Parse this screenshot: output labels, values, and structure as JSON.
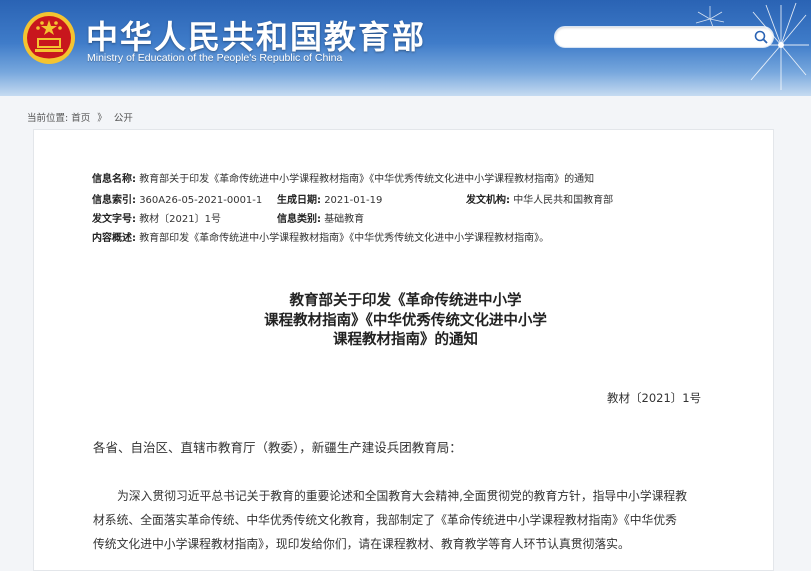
{
  "header": {
    "title": "中华人民共和国教育部",
    "subtitle": "Ministry of Education of the People's Republic of China",
    "search_placeholder": "",
    "search_icon": "search-icon",
    "emblem": "national-emblem"
  },
  "breadcrumb": {
    "prefix": "当前位置:",
    "items": [
      "首页",
      "公开"
    ],
    "separator": "》"
  },
  "meta": {
    "info_name_label": "信息名称:",
    "info_name_value": "教育部关于印发《革命传统进中小学课程教材指南》《中华优秀传统文化进中小学课程教材指南》的通知",
    "index_label": "信息索引:",
    "index_value": "360A26-05-2021-0001-1",
    "date_label": "生成日期:",
    "date_value": "2021-01-19",
    "org_label": "发文机构:",
    "org_value": "中华人民共和国教育部",
    "docno_label": "发文字号:",
    "docno_value": "教材〔2021〕1号",
    "category_label": "信息类别:",
    "category_value": "基础教育",
    "summary_label": "内容概述:",
    "summary_value": "教育部印发《革命传统进中小学课程教材指南》《中华优秀传统文化进中小学课程教材指南》。"
  },
  "document": {
    "title_lines": [
      "教育部关于印发《革命传统进中小学",
      "课程教材指南》《中华优秀传统文化进中小学",
      "课程教材指南》的通知"
    ],
    "doc_number": "教材〔2021〕1号",
    "addressee": "各省、自治区、直辖市教育厅（教委），新疆生产建设兵团教育局：",
    "body_lines": [
      "为深入贯彻习近平总书记关于教育的重要论述和全国教育大会精神,全面贯彻党的教育方针，指导中小学课程教",
      "材系统、全面落实革命传统、中华优秀传统文化教育，我部制定了《革命传统进中小学课程教材指南》《中华优秀",
      "传统文化进中小学课程教材指南》，现印发给你们，请在课程教材、教育教学等育人环节认真贯彻落实。"
    ]
  },
  "colors": {
    "header_blue": "#2a63b4",
    "emblem_red": "#c8161d",
    "emblem_gold": "#f4c430"
  }
}
